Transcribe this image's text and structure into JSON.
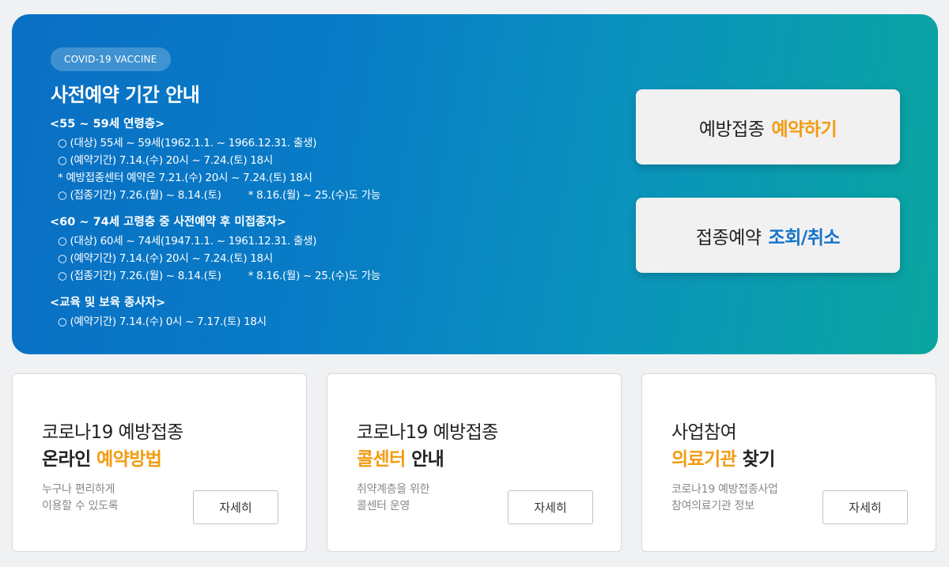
{
  "hero": {
    "badge": "COVID-19 VACCINE",
    "title": "사전예약 기간 안내",
    "groups": [
      {
        "title": "<55 ~ 59세 연령층>",
        "lines": [
          "○ (대상) 55세 ~ 59세(1962.1.1. ~ 1966.12.31. 출생)",
          "○ (예약기간) 7.14.(수) 20시 ~ 7.24.(토) 18시",
          "* 예방접종센터 예약은 7.21.(수) 20시 ~ 7.24.(토) 18시",
          "○ (접종기간) 7.26.(월) ~ 8.14.(토)"
        ],
        "note": "* 8.16.(월) ~ 25.(수)도 가능"
      },
      {
        "title": "<60 ~ 74세 고령층 중 사전예약 후 미접종자>",
        "lines": [
          "○ (대상) 60세 ~ 74세(1947.1.1. ~ 1961.12.31. 출생)",
          "○ (예약기간) 7.14.(수) 20시 ~ 7.24.(토) 18시",
          "○ (접종기간) 7.26.(월) ~ 8.14.(토)"
        ],
        "note": "* 8.16.(월) ~ 25.(수)도 가능"
      },
      {
        "title": "<교육 및 보육 종사자>",
        "lines": [
          "○ (예약기간) 7.14.(수) 0시 ~ 7.17.(토) 18시"
        ]
      }
    ]
  },
  "actions": {
    "reserve": {
      "prefix": "예방접종",
      "highlight": "예약하기"
    },
    "lookup": {
      "prefix": "접종예약",
      "highlight": "조회/취소"
    }
  },
  "cards": [
    {
      "line1": "코로나19 예방접종",
      "line2_prefix": "온라인",
      "line2_highlight": "예약방법",
      "desc": [
        "누구나 편리하게",
        "이용할 수 있도록"
      ],
      "button": "자세히"
    },
    {
      "line1": "코로나19 예방접종",
      "line2_prefix": "",
      "line2_highlight": "콜센터",
      "line2_suffix": "안내",
      "desc": [
        "취약계층을 위한",
        "콜센터 운영"
      ],
      "button": "자세히"
    },
    {
      "line1": "사업참여",
      "line2_prefix": "",
      "line2_highlight": "의료기관",
      "line2_suffix": "찾기",
      "desc": [
        "코로나19 예방접종사업",
        "참여의료기관 정보"
      ],
      "button": "자세히"
    }
  ],
  "colors": {
    "accent_orange": "#f39c12",
    "accent_blue": "#1473c9",
    "hero_start": "#0a6fc4",
    "hero_end": "#0aa59f"
  }
}
